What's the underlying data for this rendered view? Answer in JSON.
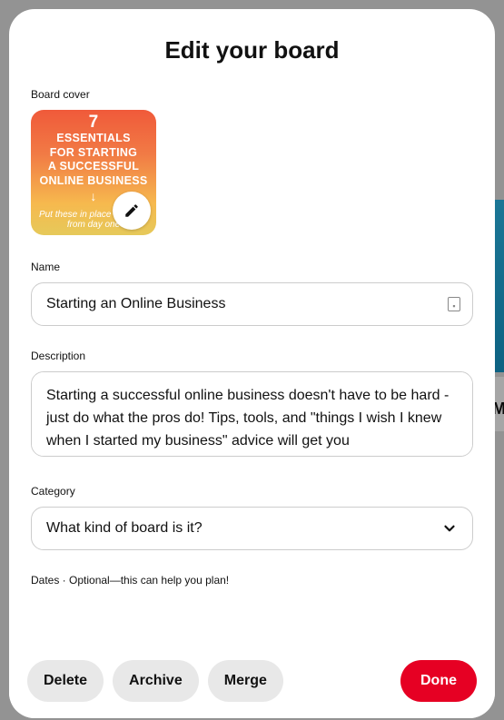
{
  "modal": {
    "title": "Edit your board"
  },
  "cover": {
    "label": "Board cover",
    "line_top": "7",
    "line1": "ESSENTIALS",
    "line2": "FOR STARTING",
    "line3": "A SUCCESSFUL",
    "line4": "ONLINE BUSINESS",
    "arrow": "↓",
    "sub": "Put these in place & go pro from day one"
  },
  "name": {
    "label": "Name",
    "value": "Starting an Online Business"
  },
  "description": {
    "label": "Description",
    "value": "Starting a successful online business doesn't have to be hard - just do what the pros do! Tips, tools, and \"things I wish I knew when I started my business\" advice will get you"
  },
  "category": {
    "label": "Category",
    "placeholder": "What kind of board is it?"
  },
  "dates": {
    "label": "Dates · Optional—this can help you plan!"
  },
  "buttons": {
    "delete": "Delete",
    "archive": "Archive",
    "merge": "Merge",
    "done": "Done"
  },
  "bg": {
    "initial": "M"
  }
}
